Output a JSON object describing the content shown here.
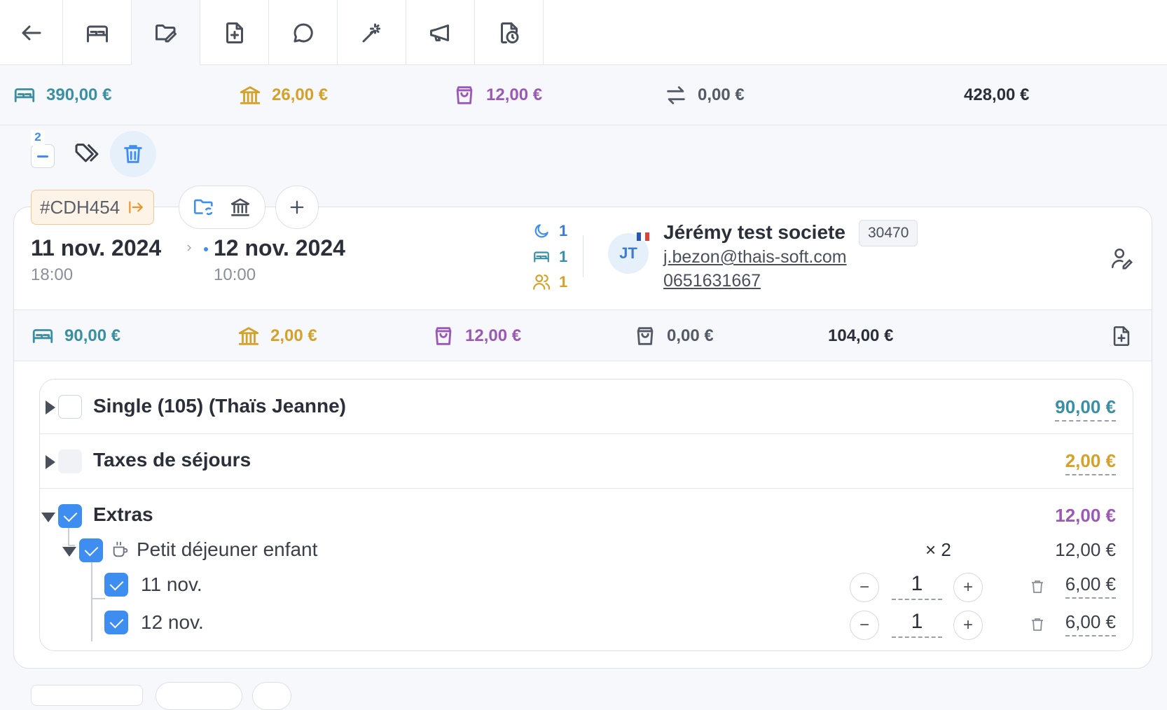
{
  "tabs": [
    {
      "name": "back-arrow-icon"
    },
    {
      "name": "bed-icon"
    },
    {
      "name": "folder-edit-icon",
      "active": true
    },
    {
      "name": "file-add-icon"
    },
    {
      "name": "chat-bubble-icon"
    },
    {
      "name": "magic-wand-icon"
    },
    {
      "name": "megaphone-icon"
    },
    {
      "name": "file-clock-icon"
    }
  ],
  "summary": {
    "rooms": "390,00 €",
    "taxes": "26,00 €",
    "extras": "12,00 €",
    "transfers": "0,00 €",
    "total": "428,00 €"
  },
  "toolbar": {
    "badge_count": "2"
  },
  "reservation": {
    "ref": "#CDH454",
    "arrival_date": "11 nov. 2024",
    "arrival_time": "18:00",
    "departure_date": "12 nov. 2024",
    "departure_time": "10:00",
    "nights": "1",
    "rooms": "1",
    "guests": "1"
  },
  "guest": {
    "initials": "JT",
    "name": "Jérémy test societe",
    "zip": "30470",
    "email": "j.bezon@thais-soft.com",
    "phone": "0651631667"
  },
  "subsummary": {
    "rooms": "90,00 €",
    "taxes": "2,00 €",
    "extras": "12,00 €",
    "other": "0,00 €",
    "total": "104,00 €"
  },
  "lines": {
    "room_label": "Single (105) (Thaïs Jeanne)",
    "room_amount": "90,00 €",
    "tax_label": "Taxes de séjours",
    "tax_amount": "2,00 €",
    "extras_label": "Extras",
    "extras_amount": "12,00 €",
    "item_label": "Petit déjeuner enfant",
    "item_mult": "× 2",
    "item_amount": "12,00 €",
    "days": [
      {
        "label": "11 nov.",
        "qty": "1",
        "amount": "6,00 €"
      },
      {
        "label": "12 nov.",
        "qty": "1",
        "amount": "6,00 €"
      }
    ],
    "minus": "−",
    "plus": "+"
  },
  "colors": {
    "teal": "#3a8fa3",
    "gold": "#d4a12a",
    "purple": "#9b59b6",
    "accent": "#3d8ef0"
  }
}
